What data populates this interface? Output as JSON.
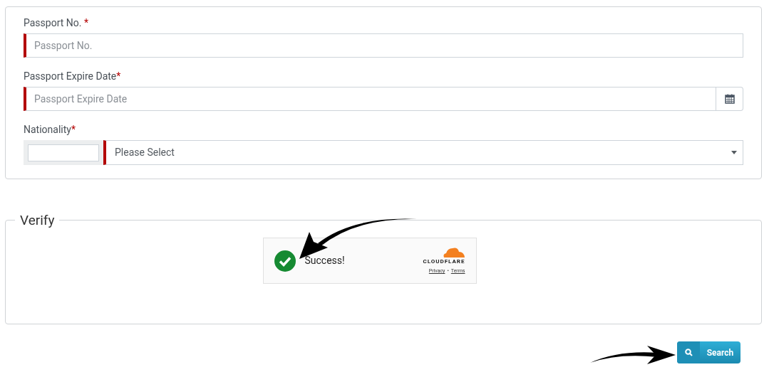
{
  "form": {
    "fields": [
      {
        "kind": "text",
        "label": "Passport No. ",
        "required_mark": "*",
        "placeholder": "Passport No."
      },
      {
        "kind": "date",
        "label": "Passport Expire Date",
        "required_mark": "*",
        "placeholder": "Passport Expire Date"
      },
      {
        "kind": "select",
        "label": "Nationality",
        "required_mark": "*",
        "value": "Please Select"
      }
    ]
  },
  "verify": {
    "legend": "Verify",
    "widget": {
      "status": "Success!",
      "brand": "CLOUDFLARE",
      "links": [
        "Privacy",
        "Terms"
      ],
      "separator": "•"
    }
  },
  "search_button": {
    "label": "Search"
  }
}
